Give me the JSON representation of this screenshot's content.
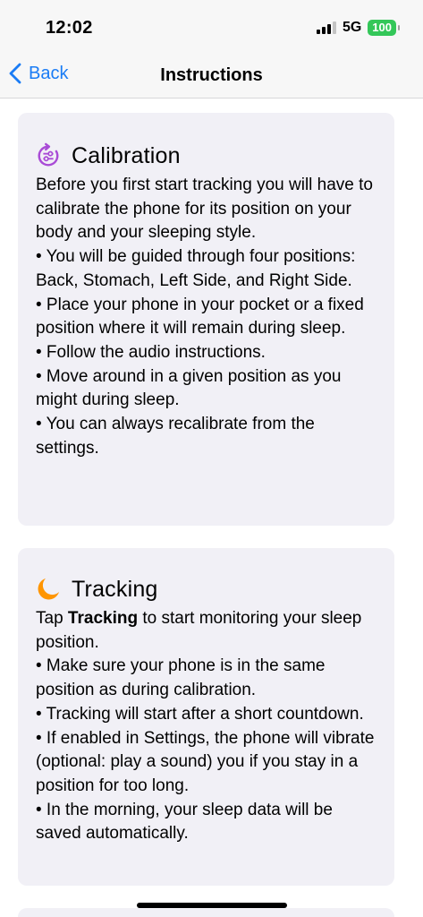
{
  "status": {
    "time": "12:02",
    "network": "5G",
    "battery": "100"
  },
  "nav": {
    "back_label": "Back",
    "title": "Instructions"
  },
  "calibration": {
    "title": "Calibration",
    "intro": "Before you first start tracking you will have to calibrate the phone for its position on your body and your sleeping style.",
    "bullets": [
      "• You will be guided through four positions: Back, Stomach, Left Side, and Right Side.",
      "• Place your phone in your pocket or a fixed position where it will remain during sleep.",
      "• Follow the audio instructions.",
      "• Move around in a given position as you might during sleep.",
      "• You can always recalibrate from the settings."
    ]
  },
  "tracking": {
    "title": "Tracking",
    "intro_prefix": "Tap ",
    "intro_bold": "Tracking",
    "intro_suffix": " to start monitoring your sleep position.",
    "bullets": [
      "• Make sure your phone is in the same position as during calibration.",
      "• Tracking will start after a short countdown.",
      "• If enabled in Settings, the phone will vibrate (optional: play a sound) you if you stay in a position for too long.",
      "• In the morning, your sleep data will be saved automatically."
    ]
  },
  "colors": {
    "accent": "#1a7cf5",
    "calibration_icon": "#a94bd6",
    "tracking_icon": "#ff9500",
    "battery": "#34c759"
  },
  "icons": {
    "back": "chevron-left-icon",
    "calibration": "sliders-refresh-icon",
    "tracking": "moon-icon"
  }
}
